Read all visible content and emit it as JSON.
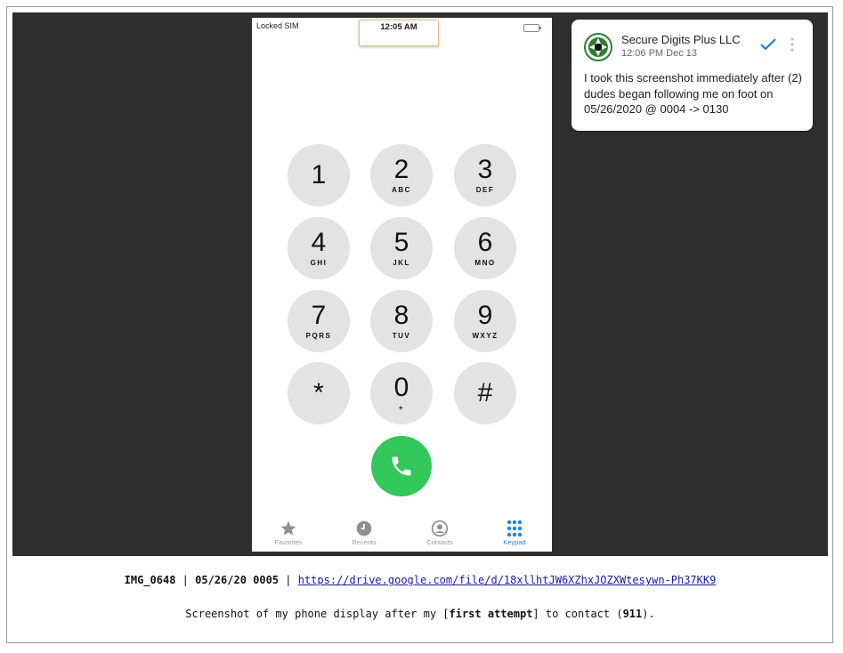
{
  "phone": {
    "status": {
      "carrier": "Locked SIM",
      "time": "12:05 AM"
    },
    "keypad": [
      {
        "digit": "1",
        "letters": ""
      },
      {
        "digit": "2",
        "letters": "ABC"
      },
      {
        "digit": "3",
        "letters": "DEF"
      },
      {
        "digit": "4",
        "letters": "GHI"
      },
      {
        "digit": "5",
        "letters": "JKL"
      },
      {
        "digit": "6",
        "letters": "MNO"
      },
      {
        "digit": "7",
        "letters": "PQRS"
      },
      {
        "digit": "8",
        "letters": "TUV"
      },
      {
        "digit": "9",
        "letters": "WXYZ"
      },
      {
        "digit": "*",
        "letters": ""
      },
      {
        "digit": "0",
        "letters": "+"
      },
      {
        "digit": "#",
        "letters": ""
      }
    ],
    "call_icon": "phone-icon",
    "tabs": [
      {
        "label": "Favorites",
        "icon": "star-icon",
        "active": false
      },
      {
        "label": "Recents",
        "icon": "clock-icon",
        "active": false
      },
      {
        "label": "Contacts",
        "icon": "person-icon",
        "active": false
      },
      {
        "label": "Keypad",
        "icon": "keypad-icon",
        "active": true
      }
    ],
    "colors": {
      "call": "#34c759",
      "active_tab": "#1e88e5",
      "key": "#e3e3e3"
    }
  },
  "comment": {
    "author": "Secure Digits Plus LLC",
    "timestamp": "12:06 PM Dec 13",
    "text": "I took this screenshot immediately after (2) dudes began following me on foot on 05/26/2020 @ 0004 -> 0130"
  },
  "caption": {
    "file": "IMG_0648",
    "sep1": " | ",
    "date": "05/26/20 0005",
    "sep2": " | ",
    "link": "https://drive.google.com/file/d/18xllhtJW6XZhxJOZXWtesywn-Ph37KK9",
    "desc_before": "Screenshot of my phone display after my [",
    "desc_bold1": "first attempt",
    "desc_middle": "] to contact (",
    "desc_bold2": "911",
    "desc_after": ")."
  }
}
